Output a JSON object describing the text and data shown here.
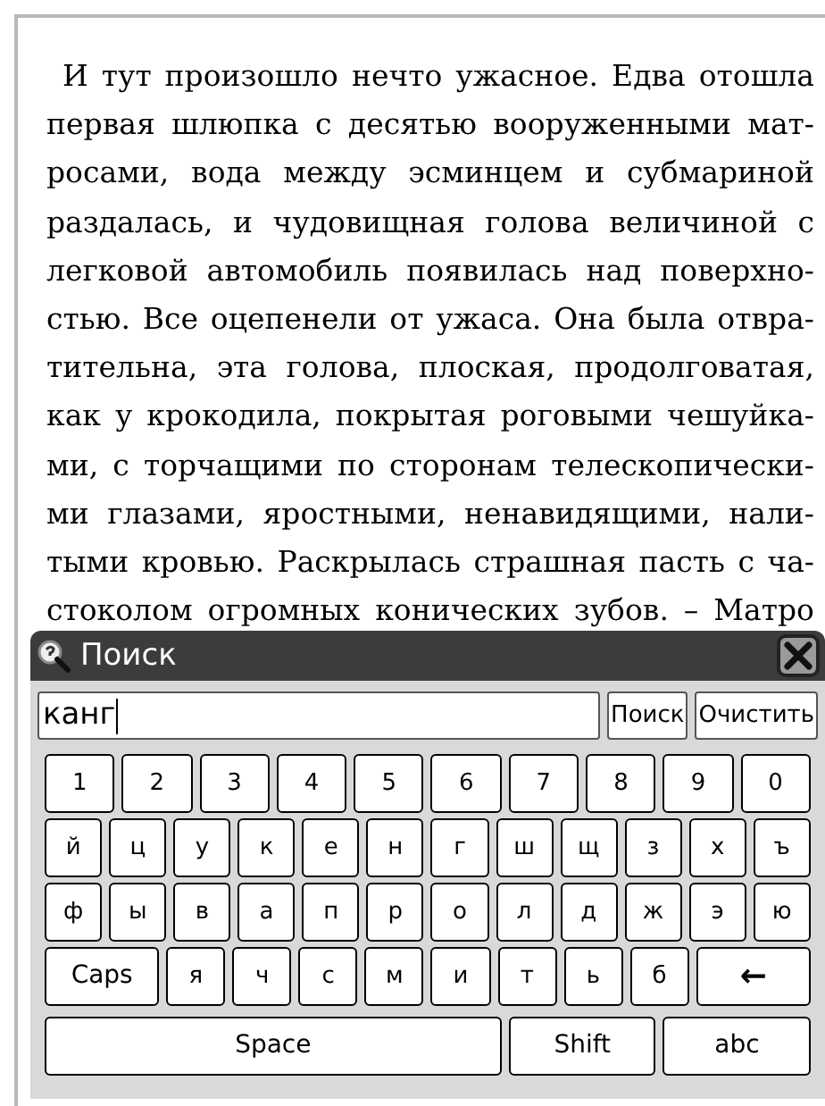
{
  "page": {
    "lines": [
      "И тут произошло нечто ужасное. Едва отошла",
      "первая шлюпка с десятью вооруженными мат-",
      "росами, вода между эсминцем и субмариной",
      "раздалась, и чудовищная голова величиной с",
      "легковой автомобиль появилась над поверхно-",
      "стью. Все оцепенели от ужаса. Она была отвра-",
      "тительна, эта голова, плоская, продолговатая,",
      "как у крокодила, покрытая роговыми чешуйка-",
      "ми, с торчащими по сторонам телескопически-",
      "ми глазами, яростными, ненавидящими, нали-",
      "тыми кровью. Раскрылась страшная пасть с ча-",
      "стоколом огромных конических зубов. – Матро"
    ]
  },
  "search_dialog": {
    "title": "Поиск",
    "query": "канг",
    "buttons": [
      "Поиск",
      "Очистить"
    ],
    "keyboard": [
      [
        {
          "kind": "char",
          "label": "1"
        },
        {
          "kind": "char",
          "label": "2"
        },
        {
          "kind": "char",
          "label": "3"
        },
        {
          "kind": "char",
          "label": "4"
        },
        {
          "kind": "char",
          "label": "5"
        },
        {
          "kind": "char",
          "label": "6"
        },
        {
          "kind": "char",
          "label": "7"
        },
        {
          "kind": "char",
          "label": "8"
        },
        {
          "kind": "char",
          "label": "9"
        },
        {
          "kind": "char",
          "label": "0"
        }
      ],
      [
        {
          "kind": "char",
          "label": "й"
        },
        {
          "kind": "char",
          "label": "ц"
        },
        {
          "kind": "char",
          "label": "у"
        },
        {
          "kind": "char",
          "label": "к"
        },
        {
          "kind": "char",
          "label": "е"
        },
        {
          "kind": "char",
          "label": "н"
        },
        {
          "kind": "char",
          "label": "г"
        },
        {
          "kind": "char",
          "label": "ш"
        },
        {
          "kind": "char",
          "label": "щ"
        },
        {
          "kind": "char",
          "label": "з"
        },
        {
          "kind": "char",
          "label": "х"
        },
        {
          "kind": "char",
          "label": "ъ"
        }
      ],
      [
        {
          "kind": "char",
          "label": "ф"
        },
        {
          "kind": "char",
          "label": "ы"
        },
        {
          "kind": "char",
          "label": "в"
        },
        {
          "kind": "char",
          "label": "а"
        },
        {
          "kind": "char",
          "label": "п"
        },
        {
          "kind": "char",
          "label": "р"
        },
        {
          "kind": "char",
          "label": "о"
        },
        {
          "kind": "char",
          "label": "л"
        },
        {
          "kind": "char",
          "label": "д"
        },
        {
          "kind": "char",
          "label": "ж"
        },
        {
          "kind": "char",
          "label": "э"
        },
        {
          "kind": "char",
          "label": "ю"
        }
      ],
      [
        {
          "kind": "caps",
          "label": "Caps"
        },
        {
          "kind": "char",
          "label": "я"
        },
        {
          "kind": "char",
          "label": "ч"
        },
        {
          "kind": "char",
          "label": "с"
        },
        {
          "kind": "char",
          "label": "м"
        },
        {
          "kind": "char",
          "label": "и"
        },
        {
          "kind": "char",
          "label": "т"
        },
        {
          "kind": "char",
          "label": "ь"
        },
        {
          "kind": "char",
          "label": "б"
        },
        {
          "kind": "backspace",
          "label": "←"
        }
      ],
      [
        {
          "kind": "space",
          "label": "Space"
        },
        {
          "kind": "shift",
          "label": "Shift"
        },
        {
          "kind": "mode",
          "label": "abc"
        }
      ]
    ]
  }
}
